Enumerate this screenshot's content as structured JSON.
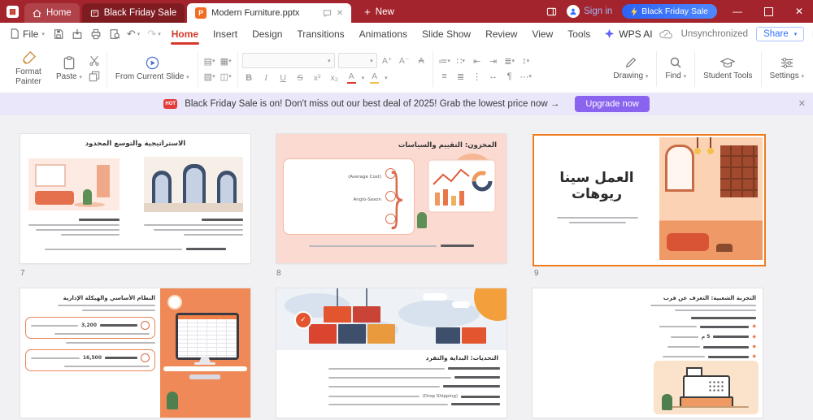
{
  "colors": {
    "titlebar_red": "#a3242c",
    "accent_blue": "#3370ff",
    "cta_purple": "#8a63ee",
    "selection_orange": "#f07c1e",
    "slide_accent": "#e8835a"
  },
  "titlebar": {
    "home_tab": "Home",
    "promo_tab": "Black Friday Sale",
    "doc_tab": "Modern Furniture.pptx",
    "new_label": "New",
    "sign_in": "Sign in",
    "promo_button": "Black Friday Sale"
  },
  "menubar": {
    "file": "File",
    "tabs": [
      "Home",
      "Insert",
      "Design",
      "Transitions",
      "Animations",
      "Slide Show",
      "Review",
      "View",
      "Tools"
    ],
    "active_tab": "Home",
    "wps_ai": "WPS AI",
    "sync_status": "Unsynchronized",
    "share": "Share"
  },
  "ribbon": {
    "format_painter": "Format Painter",
    "paste": "Paste",
    "from_current_slide": "From Current Slide",
    "drawing": "Drawing",
    "find": "Find",
    "student_tools": "Student Tools",
    "settings": "Settings"
  },
  "banner": {
    "message": "Black Friday Sale is on! Don't miss out our best deal of 2025! Grab the lowest price now →",
    "cta": "Upgrade now"
  },
  "slides": {
    "s7": {
      "number": "7",
      "title": "الاستراتيجية والتوسع المحدود"
    },
    "s8": {
      "number": "8",
      "title": "المخزون: التقييم والسياسات",
      "latin1": "(Average Cost)",
      "latin2": "Anglo-Saxon"
    },
    "s9": {
      "number": "9",
      "title": "العمل سينا ريوهات"
    },
    "s10": {
      "title": "النظام الأساسي والهيكلة الإدارية",
      "value1": "3,200",
      "value2": "16,500"
    },
    "s11": {
      "title": "التحديات: البداية والتفرد",
      "latin1": "(Drop Shipping)"
    },
    "s12": {
      "title": "التجربة الشعبية: التعرف عن قرب",
      "value1": "5 م"
    }
  }
}
